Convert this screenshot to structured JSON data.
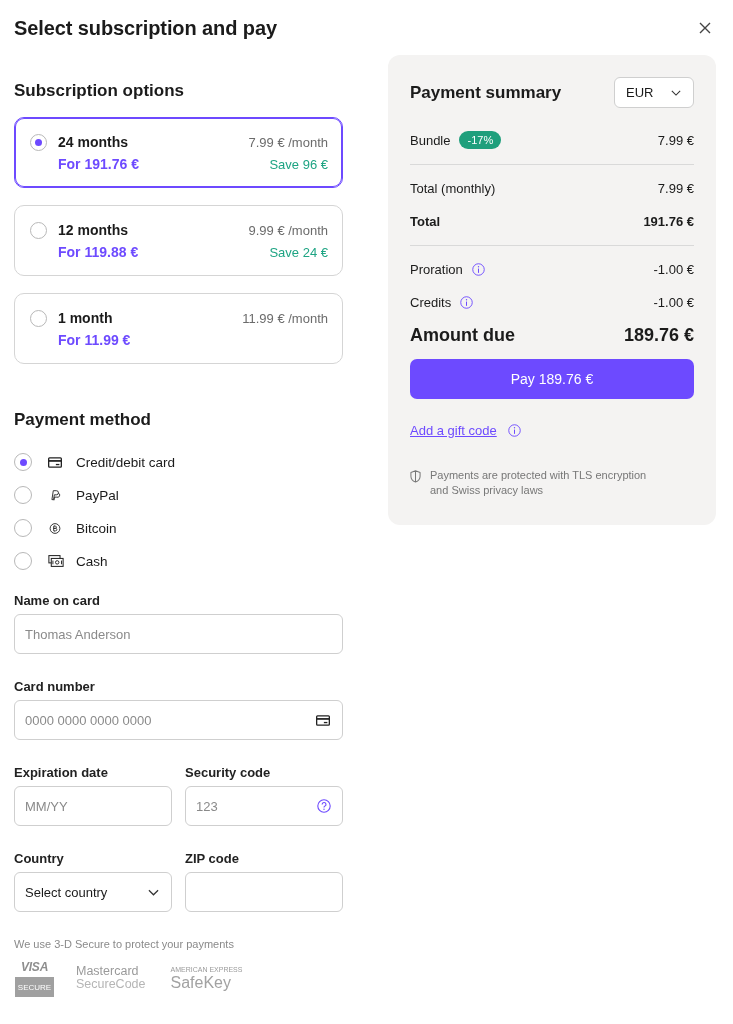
{
  "title": "Select subscription and pay",
  "subscription": {
    "heading": "Subscription options",
    "options": [
      {
        "duration": "24 months",
        "price": "For 191.76 €",
        "monthly": "7.99 € /month",
        "saving": "Save 96 €",
        "selected": true
      },
      {
        "duration": "12 months",
        "price": "For 119.88 €",
        "monthly": "9.99 € /month",
        "saving": "Save 24 €",
        "selected": false
      },
      {
        "duration": "1 month",
        "price": "For 11.99 €",
        "monthly": "11.99 € /month",
        "selected": false
      }
    ]
  },
  "payment_method": {
    "heading": "Payment method",
    "methods": [
      {
        "label": "Credit/debit card",
        "kind": "card",
        "selected": true
      },
      {
        "label": "PayPal",
        "kind": "paypal",
        "selected": false
      },
      {
        "label": "Bitcoin",
        "kind": "bitcoin",
        "selected": false
      },
      {
        "label": "Cash",
        "kind": "cash",
        "selected": false
      }
    ]
  },
  "card_form": {
    "rows": [
      [
        {
          "label": "Name on card",
          "kind": "text",
          "placeholder": "Thomas Anderson"
        }
      ],
      [
        {
          "label": "Card number",
          "kind": "cardnumber",
          "placeholder": "0000 0000 0000 0000"
        }
      ],
      [
        {
          "label": "Expiration date",
          "kind": "text",
          "placeholder": "MM/YY"
        },
        {
          "label": "Security code",
          "kind": "cvc",
          "placeholder": "123"
        }
      ],
      [
        {
          "label": "Country",
          "kind": "select",
          "value": "Select country"
        },
        {
          "label": "ZIP code",
          "kind": "text"
        }
      ]
    ],
    "secure_note": "We use 3-D Secure to protect your payments",
    "logos": [
      {
        "kind": "visa",
        "lines": [
          "VISA",
          "SECURE"
        ]
      },
      {
        "kind": "mastercard",
        "lines": [
          "Mastercard",
          "SecureCode"
        ]
      },
      {
        "kind": "amex",
        "lines": [
          "AMERICAN EXPRESS",
          "SafeKey"
        ]
      }
    ]
  },
  "summary": {
    "heading": "Payment summary",
    "currency": "EUR",
    "groups": [
      [
        {
          "label": "Bundle",
          "badge": "-17%",
          "info": false,
          "amount": "7.99 €",
          "kind": "line"
        }
      ],
      [
        {
          "label": "Total (monthly)",
          "info": false,
          "amount": "7.99 €",
          "kind": "line"
        },
        {
          "label": "Total",
          "info": false,
          "amount": "191.76 €",
          "kind": "total"
        }
      ],
      [
        {
          "label": "Proration",
          "info": true,
          "amount": "-1.00 €",
          "kind": "line"
        },
        {
          "label": "Credits",
          "info": true,
          "amount": "-1.00 €",
          "kind": "line"
        }
      ]
    ],
    "amount_due": {
      "label": "Amount due",
      "amount": "189.76 €"
    },
    "pay_button": "Pay 189.76 €",
    "gift_link": {
      "label": "Add a gift code",
      "info": true
    },
    "protection_note": "Payments are protected with TLS encryption and Swiss privacy laws"
  }
}
